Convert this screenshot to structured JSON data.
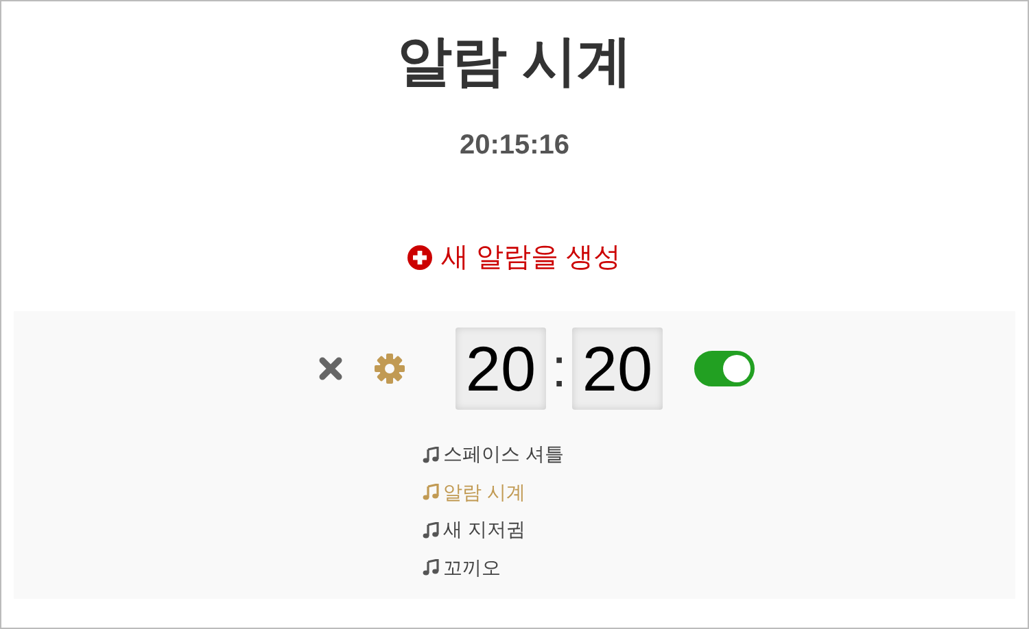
{
  "title": "알람 시계",
  "current_time": "20:15:16",
  "new_alarm_button": "새 알람을 생성",
  "alarms": [
    {
      "hour": "20",
      "separator": ":",
      "minute": "20",
      "on": true,
      "sounds": [
        {
          "label": "스페이스 셔틀",
          "selected": false
        },
        {
          "label": "알람 시계",
          "selected": true
        },
        {
          "label": "새 지저귐",
          "selected": false
        },
        {
          "label": "꼬끼오",
          "selected": false
        }
      ]
    }
  ]
}
